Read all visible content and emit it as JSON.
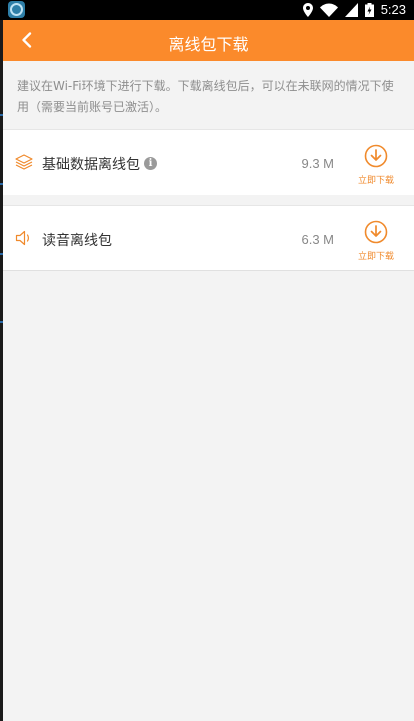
{
  "status_bar": {
    "time": "5:23"
  },
  "header": {
    "title": "离线包下载"
  },
  "notice": {
    "text": "建议在Wi-Fi环境下进行下载。下载离线包后，可以在未联网的情况下使用（需要当前账号已激活）。"
  },
  "packages": [
    {
      "name": "基础数据离线包",
      "size": "9.3 M",
      "action": "立即下载",
      "icon": "layers-icon",
      "has_info": true
    },
    {
      "name": "读音离线包",
      "size": "6.3 M",
      "action": "立即下载",
      "icon": "speaker-icon",
      "has_info": false
    }
  ],
  "colors": {
    "accent": "#fb8a2b",
    "background": "#f3f3f3"
  }
}
